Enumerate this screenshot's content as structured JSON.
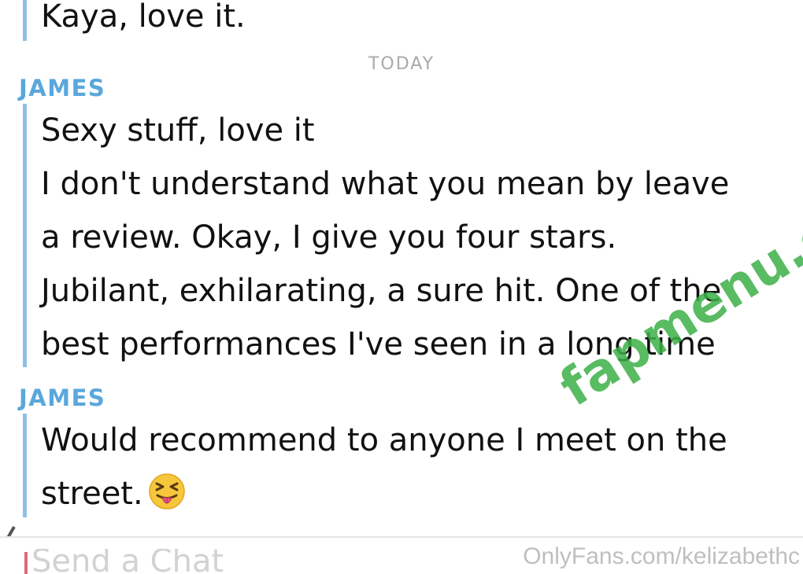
{
  "top_message": {
    "lines": [
      "Kaya, love it."
    ]
  },
  "day_separator": "TODAY",
  "messages": [
    {
      "sender": "JAMES",
      "lines": [
        "Sexy stuff, love it",
        "I don't understand what you mean by leave",
        "a review. Okay, I give you four stars.",
        "Jubilant, exhilarating, a sure hit. One of the",
        "best performances I've seen in a long time"
      ]
    },
    {
      "sender": "JAMES",
      "lines": [
        "Would recommend to anyone I meet on the",
        "street."
      ],
      "emoji": "squinting-face-with-tongue"
    }
  ],
  "composer": {
    "placeholder": "Send a Chat"
  },
  "watermark": {
    "url": "OnlyFans.com/kelizabethc",
    "logo": "fapmenu.com"
  },
  "colors": {
    "sender": "#5aa7dc",
    "quote_bar": "#8cc1e6",
    "text": "#111111",
    "separator": "#a9a9a9",
    "composer_caret": "#d96a7a",
    "watermark_logo": "#3caf46"
  }
}
